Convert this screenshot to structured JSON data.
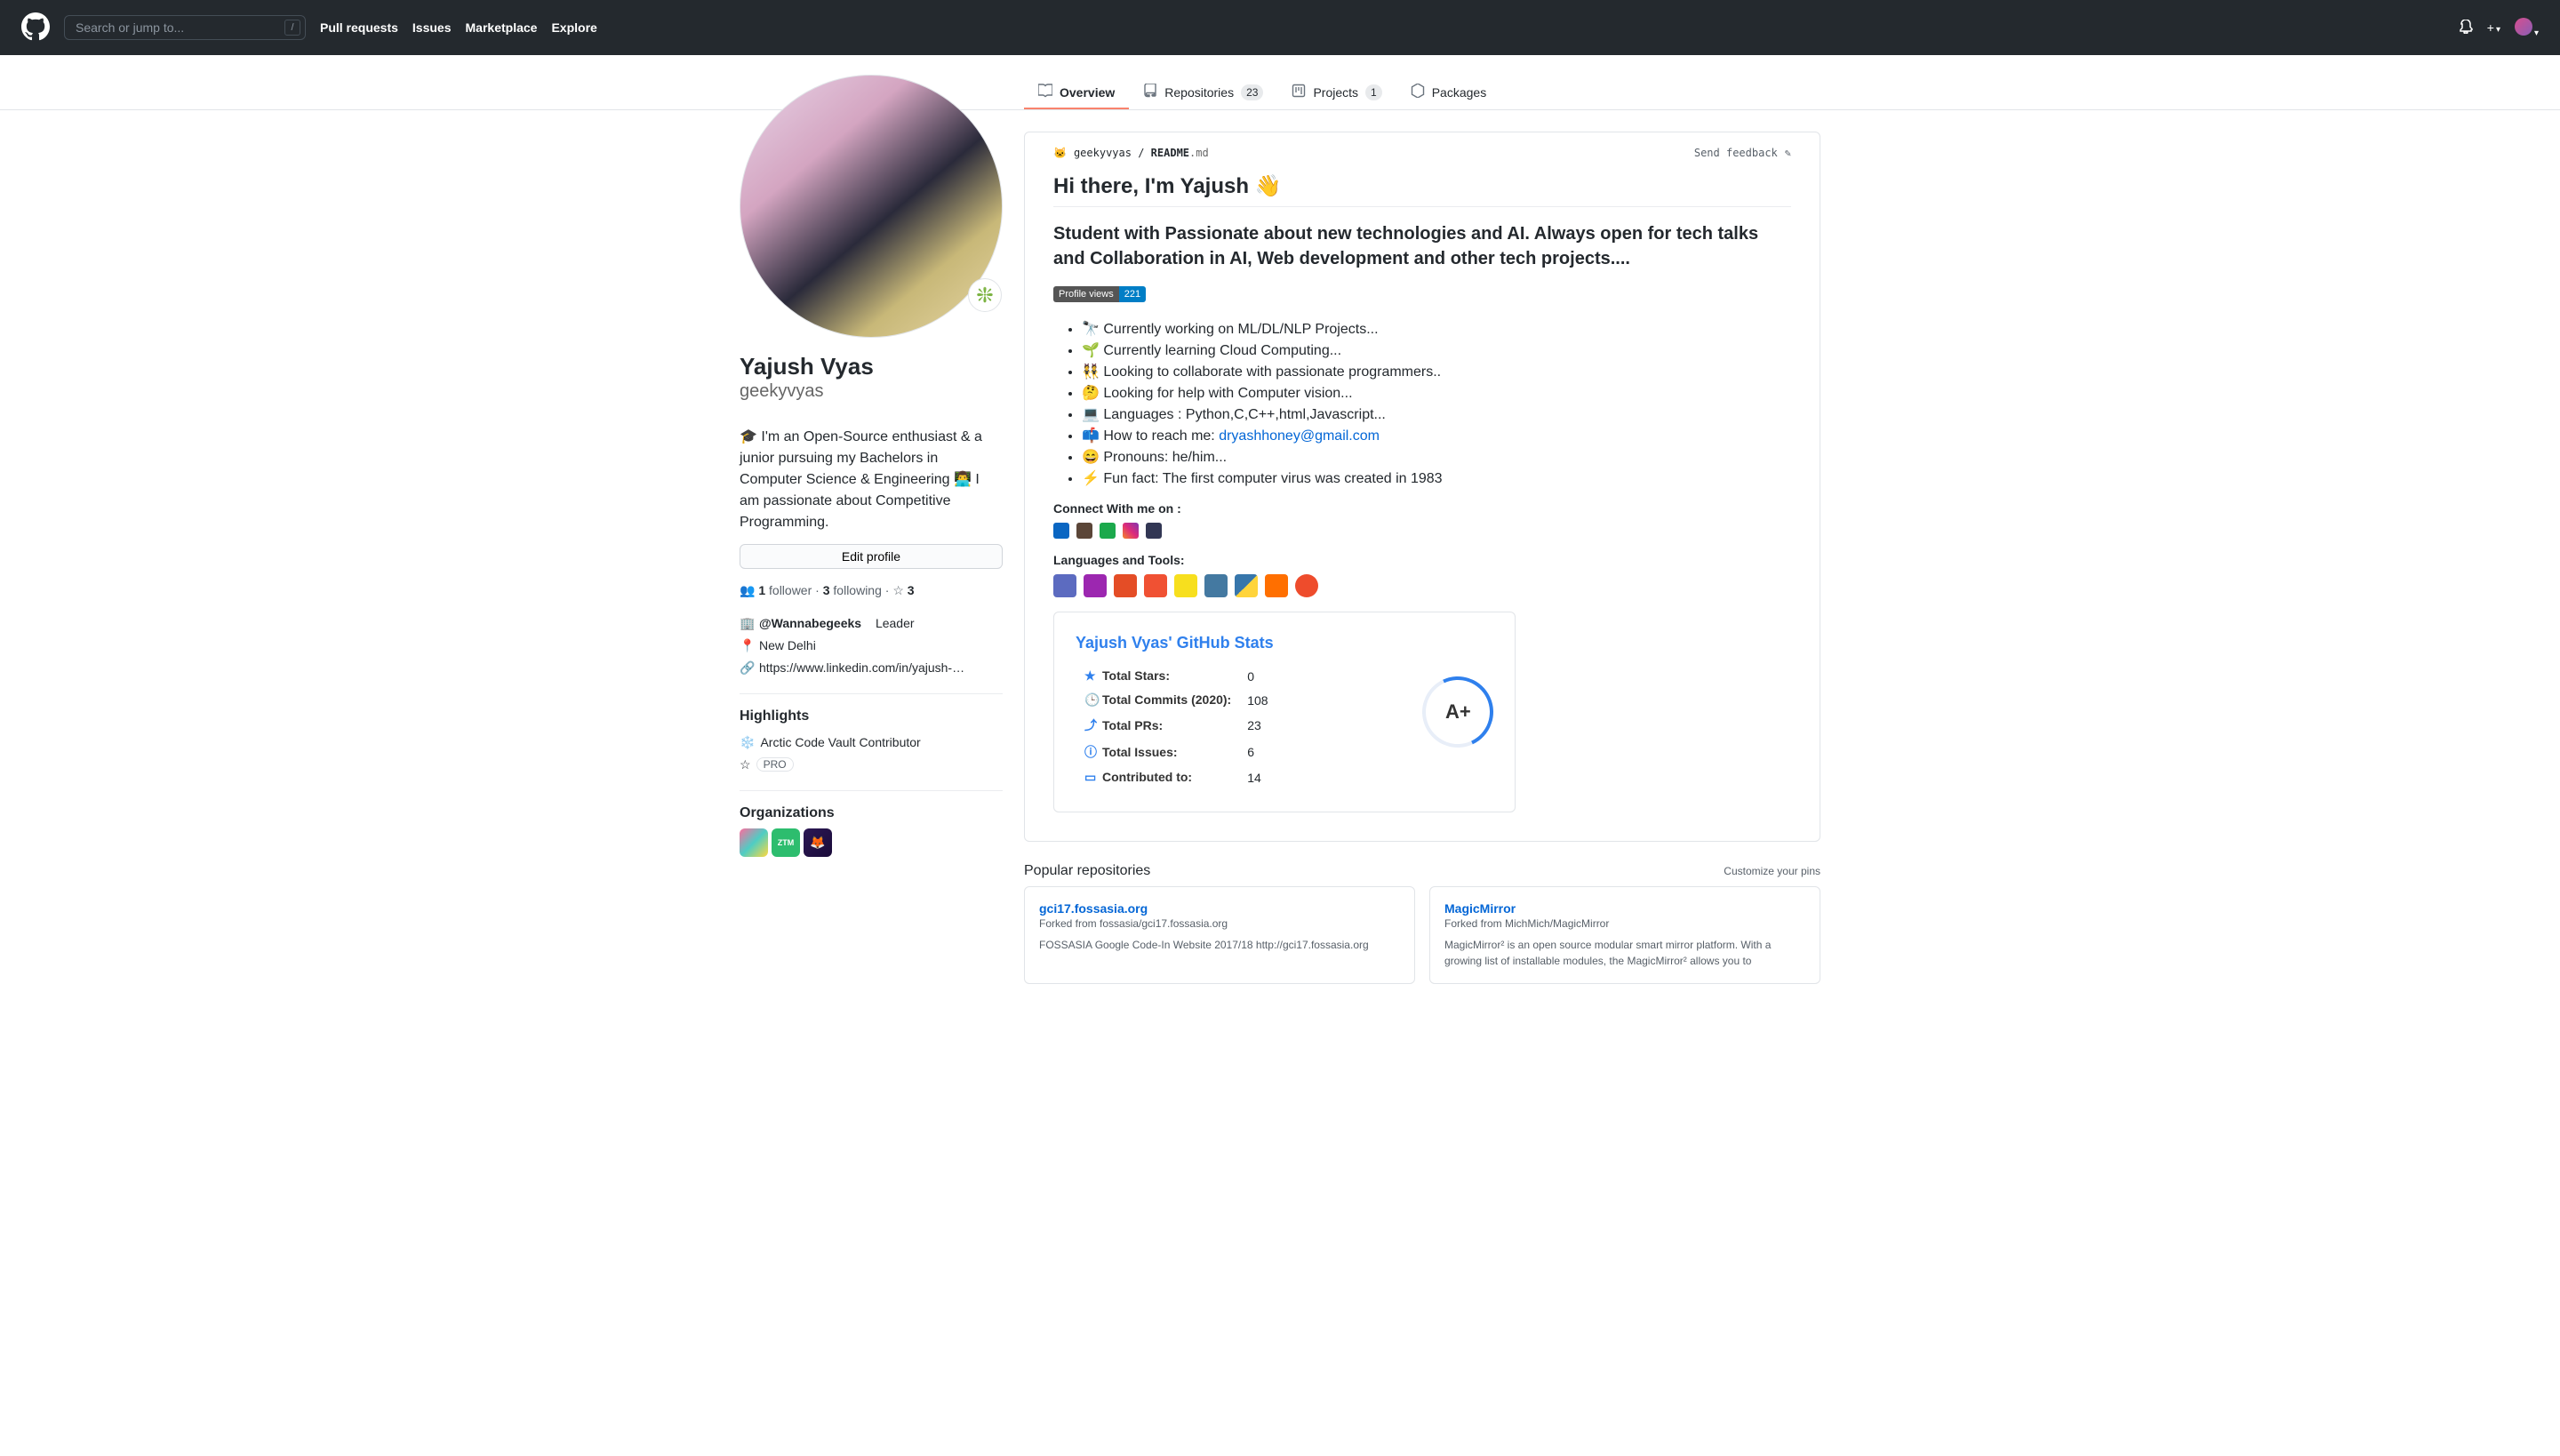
{
  "header": {
    "search_placeholder": "Search or jump to...",
    "nav": [
      "Pull requests",
      "Issues",
      "Marketplace",
      "Explore"
    ]
  },
  "tabs": {
    "overview": "Overview",
    "repositories": "Repositories",
    "repositories_count": "23",
    "projects": "Projects",
    "projects_count": "1",
    "packages": "Packages"
  },
  "profile": {
    "fullname": "Yajush Vyas",
    "username": "geekyvyas",
    "bio": "🎓 I'm an Open-Source enthusiast & a junior pursuing my Bachelors in Computer Science & Engineering 👨‍💻 I am passionate about Competitive Programming.",
    "edit_label": "Edit profile",
    "followers_count": "1",
    "followers_label": "follower",
    "following_count": "3",
    "following_label": "following",
    "stars_count": "3",
    "company": "@Wannabegeeks",
    "company_role": "Leader",
    "location": "New Delhi",
    "website": "https://www.linkedin.com/in/yajush-…",
    "highlights_title": "Highlights",
    "highlight1": "Arctic Code Vault Contributor",
    "pro_label": "PRO",
    "orgs_title": "Organizations"
  },
  "readme": {
    "path_user": "geekyvyas",
    "path_file": "README",
    "path_ext": ".md",
    "feedback": "Send feedback",
    "title": "Hi there, I'm Yajush 👋",
    "subtitle": "Student with Passionate about new technologies and AI. Always open for tech talks and Collaboration in AI, Web development and other tech projects....",
    "views_label": "Profile views",
    "views_count": "221",
    "bullets": [
      "🔭 Currently working on ML/DL/NLP Projects...",
      "🌱 Currently learning Cloud Computing...",
      "👯 Looking to collaborate with passionate programmers..",
      "🤔 Looking for help with Computer vision...",
      "💻 Languages : Python,C,C++,html,Javascript...",
      "📫 How to reach me: ",
      "😄 Pronouns: he/him...",
      "⚡ Fun fact: The first computer virus was created in 1983"
    ],
    "email": "dryashhoney@gmail.com",
    "connect_label": "Connect With me on :",
    "tools_label": "Languages and Tools:"
  },
  "stats": {
    "title": "Yajush Vyas' GitHub Stats",
    "rows": [
      {
        "label": "Total Stars:",
        "value": "0"
      },
      {
        "label": "Total Commits (2020):",
        "value": "108"
      },
      {
        "label": "Total PRs:",
        "value": "23"
      },
      {
        "label": "Total Issues:",
        "value": "6"
      },
      {
        "label": "Contributed to:",
        "value": "14"
      }
    ],
    "grade": "A+"
  },
  "pins": {
    "title": "Popular repositories",
    "customize": "Customize your pins",
    "repos": [
      {
        "name": "gci17.fossasia.org",
        "forked": "Forked from fossasia/gci17.fossasia.org",
        "desc": "FOSSASIA Google Code-In Website 2017/18 http://gci17.fossasia.org"
      },
      {
        "name": "MagicMirror",
        "forked": "Forked from MichMich/MagicMirror",
        "desc": "MagicMirror² is an open source modular smart mirror platform. With a growing list of installable modules, the MagicMirror² allows you to"
      }
    ]
  }
}
